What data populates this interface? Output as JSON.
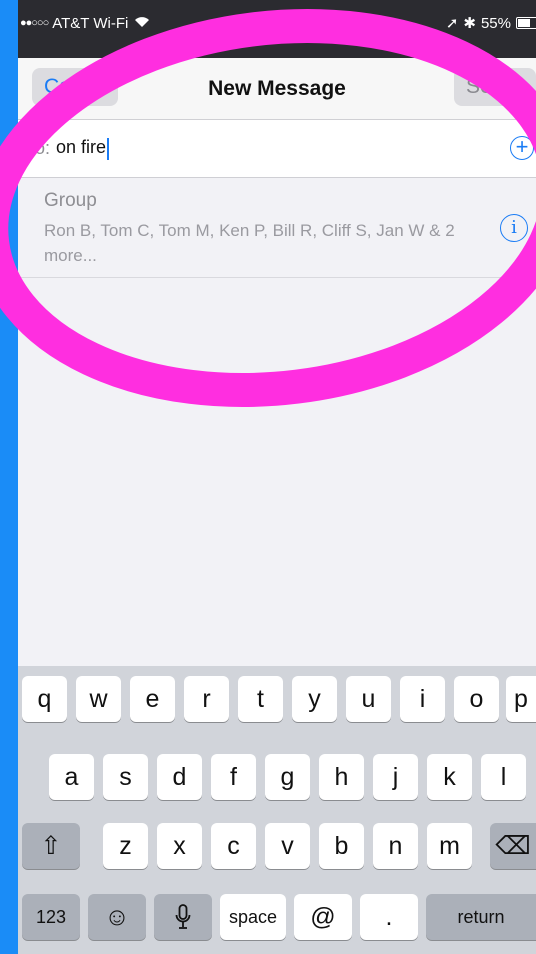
{
  "status_bar": {
    "signal": "●●○○○",
    "carrier": "AT&T Wi-Fi",
    "wifi": "wifi-icon",
    "location": "➚",
    "bluetooth": "✱",
    "battery_percent": "55%",
    "battery_level": 0.55
  },
  "compose": {
    "title": "New Message",
    "cancel_label": "Cancel",
    "send_label": "Send",
    "to_label": "To:",
    "to_value": "on fire",
    "add_icon": "+"
  },
  "suggestion": {
    "title": "Group",
    "members": "Ron B, Tom C, Tom M, Ken P, Bill R, Cliff S, Jan W & 2 more...",
    "info_icon": "i"
  },
  "keyboard": {
    "row1": [
      "q",
      "w",
      "e",
      "r",
      "t",
      "y",
      "u",
      "i",
      "o",
      "p"
    ],
    "row2": [
      "a",
      "s",
      "d",
      "f",
      "g",
      "h",
      "j",
      "k",
      "l"
    ],
    "row3": [
      "z",
      "x",
      "c",
      "v",
      "b",
      "n",
      "m"
    ],
    "shift": "⇧",
    "delete": "⌫",
    "numbers": "123",
    "emoji": "☺",
    "mic": "🎙",
    "space": "space",
    "at": "@",
    "period": ".",
    "return": "return"
  },
  "colors": {
    "accent": "#1a7cf5",
    "annotation": "#ff2ee0",
    "background": "#1a8cf7"
  }
}
